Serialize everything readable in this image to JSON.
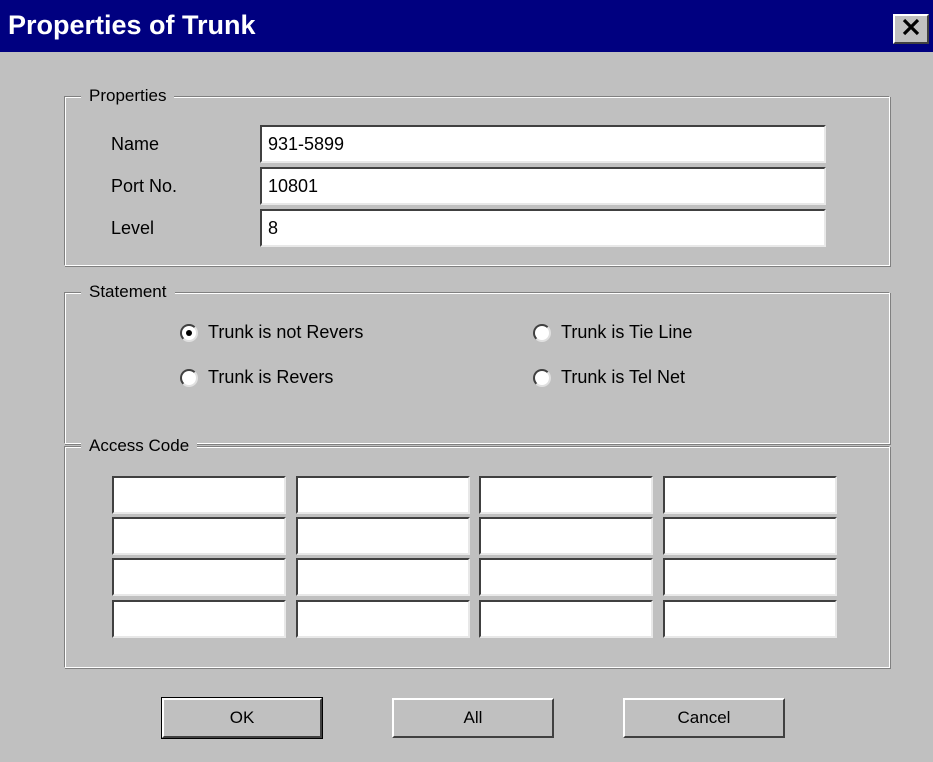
{
  "window": {
    "title": "Properties of Trunk",
    "close_icon": "close-icon"
  },
  "properties": {
    "group_label": "Properties",
    "name_label": "Name",
    "name_value": "931-5899",
    "port_label": "Port No.",
    "port_value": "10801",
    "level_label": "Level",
    "level_value": "8"
  },
  "statement": {
    "group_label": "Statement",
    "options": [
      {
        "label": "Trunk is not Revers",
        "selected": true
      },
      {
        "label": "Trunk is Tie Line",
        "selected": false
      },
      {
        "label": "Trunk is Revers",
        "selected": false
      },
      {
        "label": "Trunk is Tel Net",
        "selected": false
      }
    ]
  },
  "access_code": {
    "group_label": "Access Code",
    "cells": [
      [
        "",
        "",
        "",
        ""
      ],
      [
        "",
        "",
        "",
        ""
      ],
      [
        "",
        "",
        "",
        ""
      ],
      [
        "",
        "",
        "",
        ""
      ]
    ]
  },
  "buttons": {
    "ok": "OK",
    "all": "All",
    "cancel": "Cancel"
  },
  "colors": {
    "titlebar": "#000080",
    "face": "#c0c0c0"
  }
}
